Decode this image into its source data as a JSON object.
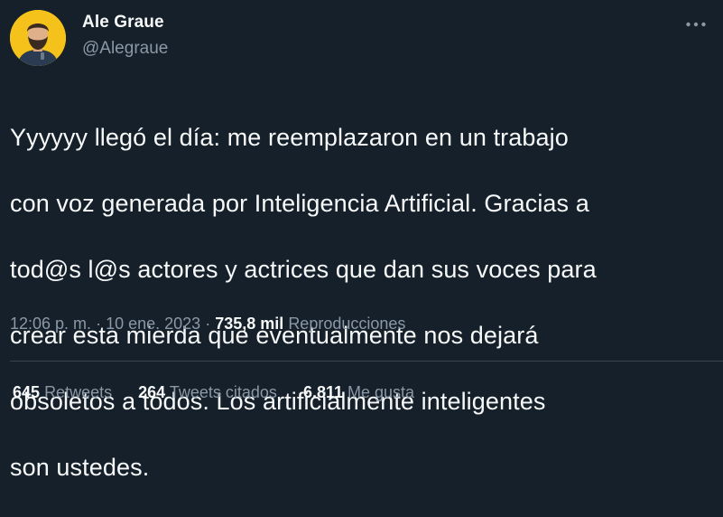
{
  "author": {
    "name": "Ale Graue",
    "handle": "@Alegraue"
  },
  "tweet": {
    "text_lines": [
      "Yyyyyy llegó el día: me reemplazaron en un trabajo",
      "con voz generada por Inteligencia Artificial. Gracias a",
      "tod@s l@s actores y actrices que dan sus voces para",
      "crear esta mierda que eventualmente nos dejará",
      "obsoletos a todos. Los artificialmente inteligentes",
      "son ustedes."
    ],
    "time": "12:06 p. m.",
    "separator": "·",
    "date": "10 ene. 2023",
    "views_count": "735,8 mil",
    "views_label": "Reproducciones"
  },
  "stats": {
    "retweets_count": "645",
    "retweets_label": "Retweets",
    "quotes_count": "264",
    "quotes_label": "Tweets citados",
    "likes_count": "6.811",
    "likes_label": "Me gusta"
  },
  "icons": {
    "more": "more-horizontal-icon"
  },
  "colors": {
    "background": "#15202b",
    "text_primary": "#f7f9f9",
    "text_secondary": "#8b98a5",
    "divider": "#38444d",
    "avatar_bg": "#f4c21a"
  }
}
